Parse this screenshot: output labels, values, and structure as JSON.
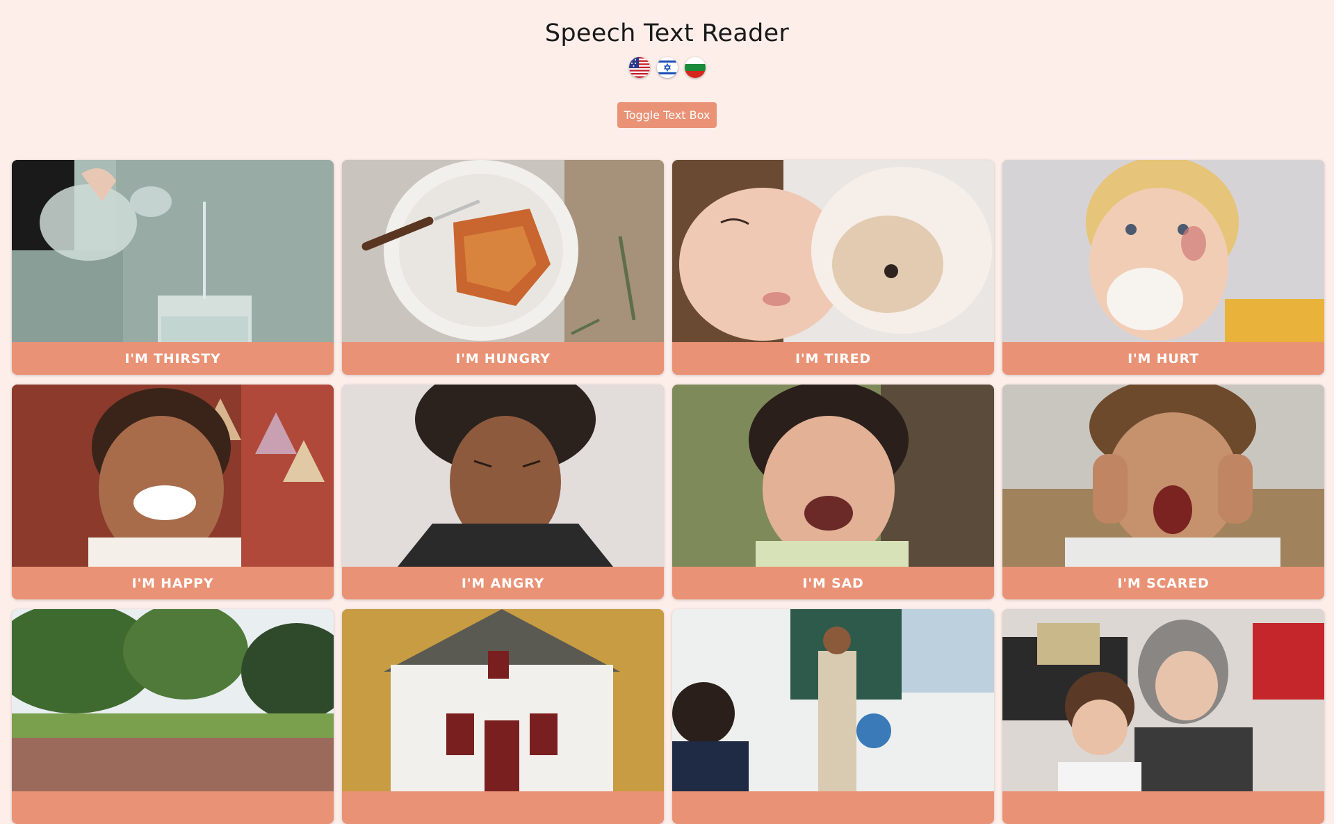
{
  "page": {
    "title": "Speech Text Reader",
    "toggle_button_label": "Toggle Text Box"
  },
  "languages": [
    {
      "name": "us-flag-icon"
    },
    {
      "name": "israel-flag-icon"
    },
    {
      "name": "bulgaria-flag-icon"
    }
  ],
  "cards": [
    {
      "label": "I'M THIRSTY",
      "image": "water-pouring-photo"
    },
    {
      "label": "I'M HUNGRY",
      "image": "lasagna-plate-photo"
    },
    {
      "label": "I'M TIRED",
      "image": "sleeping-child-photo"
    },
    {
      "label": "I'M HURT",
      "image": "hurt-boy-photo"
    },
    {
      "label": "I'M HAPPY",
      "image": "smiling-girl-photo"
    },
    {
      "label": "I'M ANGRY",
      "image": "angry-child-photo"
    },
    {
      "label": "I'M SAD",
      "image": "crying-child-photo"
    },
    {
      "label": "I'M SCARED",
      "image": "scared-boy-photo"
    },
    {
      "label": "",
      "image": "park-photo"
    },
    {
      "label": "",
      "image": "house-photo"
    },
    {
      "label": "",
      "image": "classroom-photo"
    },
    {
      "label": "",
      "image": "grandmother-boy-photo"
    }
  ],
  "colors": {
    "background": "#fdeeea",
    "accent": "#ea9275"
  }
}
